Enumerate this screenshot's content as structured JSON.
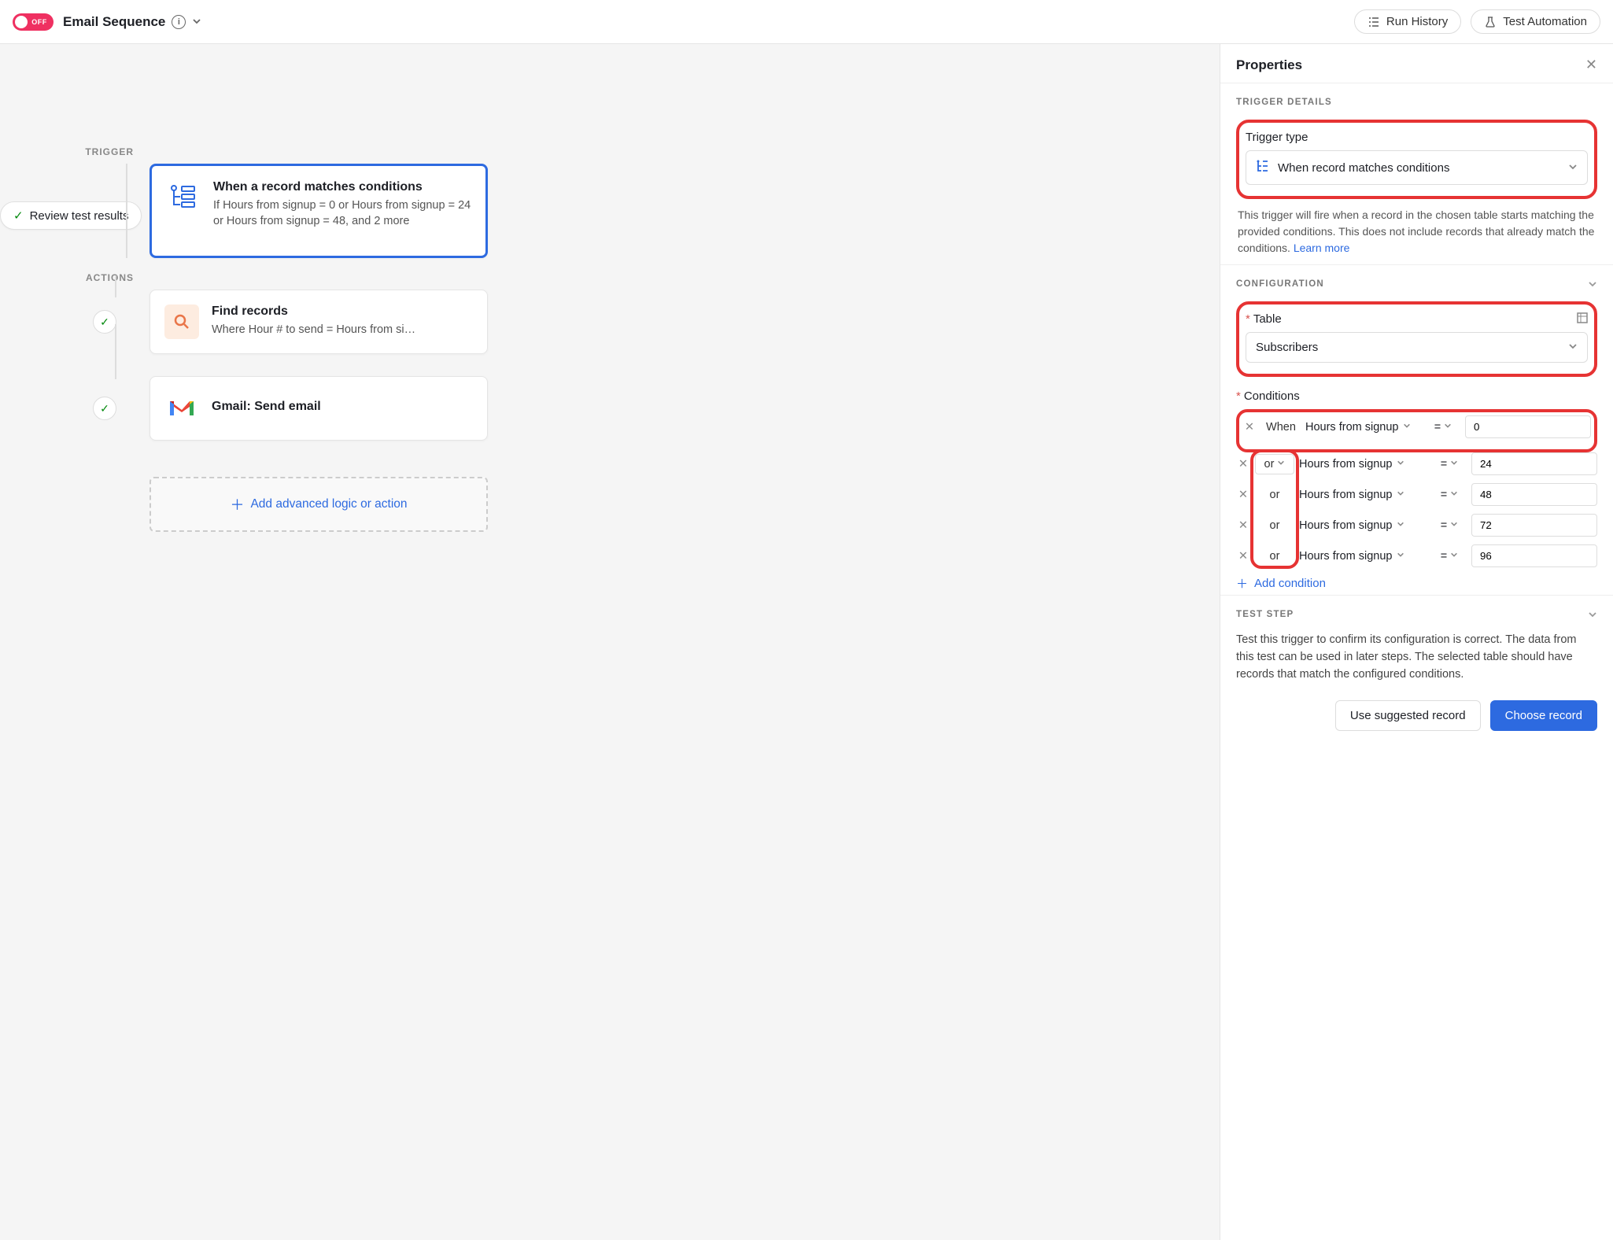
{
  "header": {
    "toggle_label": "OFF",
    "title": "Email Sequence",
    "run_history": "Run History",
    "test_automation": "Test Automation"
  },
  "canvas": {
    "review_chip": "Review test results",
    "trigger_label": "TRIGGER",
    "actions_label": "ACTIONS",
    "trigger_card": {
      "title": "When a record matches conditions",
      "subtitle": "If Hours from signup = 0 or Hours from signup = 24 or Hours from signup = 48, and 2 more"
    },
    "find_card": {
      "title": "Find records",
      "subtitle": "Where Hour # to send = Hours from si…"
    },
    "gmail_card": {
      "title": "Gmail: Send email"
    },
    "add_logic": "Add advanced logic or action"
  },
  "panel": {
    "title": "Properties",
    "trigger_details_label": "TRIGGER DETAILS",
    "trigger_type_label": "Trigger type",
    "trigger_type_value": "When record matches conditions",
    "trigger_desc": "This trigger will fire when a record in the chosen table starts matching the provided conditions. This does not include records that already match the conditions.",
    "learn_more": "Learn more",
    "configuration_label": "CONFIGURATION",
    "table_label": "Table",
    "table_value": "Subscribers",
    "conditions_label": "Conditions",
    "conditions": [
      {
        "conj": "When",
        "field": "Hours from signup",
        "op": "=",
        "value": "0"
      },
      {
        "conj": "or",
        "field": "Hours from signup",
        "op": "=",
        "value": "24"
      },
      {
        "conj": "or",
        "field": "Hours from signup",
        "op": "=",
        "value": "48"
      },
      {
        "conj": "or",
        "field": "Hours from signup",
        "op": "=",
        "value": "72"
      },
      {
        "conj": "or",
        "field": "Hours from signup",
        "op": "=",
        "value": "96"
      }
    ],
    "add_condition": "Add condition",
    "test_step_label": "TEST STEP",
    "test_step_desc": "Test this trigger to confirm its configuration is correct. The data from this test can be used in later steps. The selected table should have records that match the configured conditions.",
    "use_suggested": "Use suggested record",
    "choose_record": "Choose record"
  }
}
